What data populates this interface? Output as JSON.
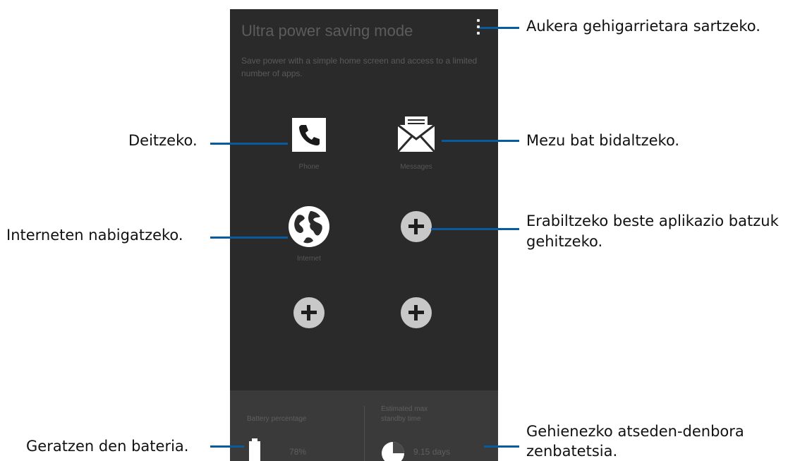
{
  "screen": {
    "title": "Ultra power saving mode",
    "description": "Save power with a simple home screen and access to a limited number of apps.",
    "more_icon": "more-vertical-icon",
    "apps": [
      {
        "label": "Phone",
        "icon": "phone-icon"
      },
      {
        "label": "Messages",
        "icon": "envelope-icon"
      },
      {
        "label": "Internet",
        "icon": "globe-icon"
      },
      {
        "label": "",
        "icon": "add-icon"
      },
      {
        "label": "",
        "icon": "add-icon"
      },
      {
        "label": "",
        "icon": "add-icon"
      }
    ],
    "status": {
      "battery_label": "Battery percentage",
      "battery_value": "78%",
      "standby_label_line1": "Estimated max",
      "standby_label_line2": "standby time",
      "standby_value": "9.15 days"
    },
    "colors": {
      "screen_bg": "#2a2a2a",
      "panel_bg": "#3a3a3a",
      "leader_line": "#0a5a9e"
    }
  },
  "callouts": {
    "options": "Aukera gehigarrietara sartzeko.",
    "call": "Deitzeko.",
    "message": "Mezu bat bidaltzeko.",
    "internet": "Interneten nabigatzeko.",
    "add_line1": "Erabiltzeko beste aplikazio batzuk",
    "add_line2": "gehitzeko.",
    "battery": "Geratzen den bateria.",
    "standby_line1": "Gehienezko atseden-denbora",
    "standby_line2": "zenbatetsia."
  }
}
